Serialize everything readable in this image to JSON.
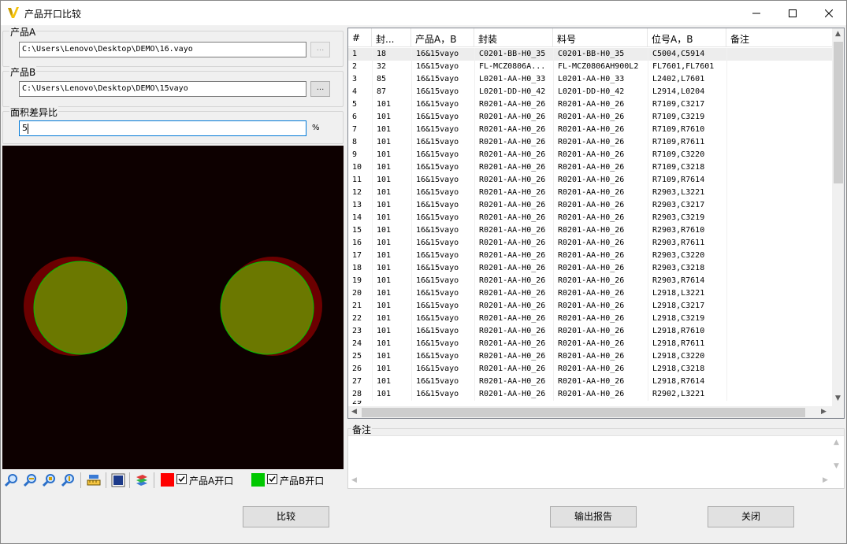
{
  "window": {
    "title": "产品开口比较"
  },
  "product_a": {
    "label": "产品A",
    "path": "C:\\Users\\Lenovo\\Desktop\\DEMO\\16.vayo",
    "browse_label": "..."
  },
  "product_b": {
    "label": "产品B",
    "path": "C:\\Users\\Lenovo\\Desktop\\DEMO\\15vayo",
    "browse_label": "..."
  },
  "area_diff": {
    "label": "面积差异比",
    "value": "5",
    "unit": "%"
  },
  "legend": {
    "a_label": "产品A开口",
    "a_color": "#ff0000",
    "a_checked": true,
    "b_label": "产品B开口",
    "b_color": "#00c800",
    "b_checked": true
  },
  "colors": {
    "canvas_bg": "#0d0000",
    "pad_a": "#6b0000",
    "pad_b": "#6b7800",
    "pad_b_outline": "#00c000"
  },
  "table": {
    "columns": [
      "#",
      "封...",
      "产品A，B",
      "封装",
      "料号",
      "位号A，B",
      "备注"
    ],
    "rows": [
      [
        "1",
        "18",
        "16&15vayo",
        "C0201-BB-H0_35",
        "C0201-BB-H0_35",
        "C5004,C5914",
        ""
      ],
      [
        "2",
        "32",
        "16&15vayo",
        "FL-MCZ0806A...",
        "FL-MCZ0806AH900L2",
        "FL7601,FL7601",
        ""
      ],
      [
        "3",
        "85",
        "16&15vayo",
        "L0201-AA-H0_33",
        "L0201-AA-H0_33",
        "L2402,L7601",
        ""
      ],
      [
        "4",
        "87",
        "16&15vayo",
        "L0201-DD-H0_42",
        "L0201-DD-H0_42",
        "L2914,L0204",
        ""
      ],
      [
        "5",
        "101",
        "16&15vayo",
        "R0201-AA-H0_26",
        "R0201-AA-H0_26",
        "R7109,C3217",
        ""
      ],
      [
        "6",
        "101",
        "16&15vayo",
        "R0201-AA-H0_26",
        "R0201-AA-H0_26",
        "R7109,C3219",
        ""
      ],
      [
        "7",
        "101",
        "16&15vayo",
        "R0201-AA-H0_26",
        "R0201-AA-H0_26",
        "R7109,R7610",
        ""
      ],
      [
        "8",
        "101",
        "16&15vayo",
        "R0201-AA-H0_26",
        "R0201-AA-H0_26",
        "R7109,R7611",
        ""
      ],
      [
        "9",
        "101",
        "16&15vayo",
        "R0201-AA-H0_26",
        "R0201-AA-H0_26",
        "R7109,C3220",
        ""
      ],
      [
        "10",
        "101",
        "16&15vayo",
        "R0201-AA-H0_26",
        "R0201-AA-H0_26",
        "R7109,C3218",
        ""
      ],
      [
        "11",
        "101",
        "16&15vayo",
        "R0201-AA-H0_26",
        "R0201-AA-H0_26",
        "R7109,R7614",
        ""
      ],
      [
        "12",
        "101",
        "16&15vayo",
        "R0201-AA-H0_26",
        "R0201-AA-H0_26",
        "R2903,L3221",
        ""
      ],
      [
        "13",
        "101",
        "16&15vayo",
        "R0201-AA-H0_26",
        "R0201-AA-H0_26",
        "R2903,C3217",
        ""
      ],
      [
        "14",
        "101",
        "16&15vayo",
        "R0201-AA-H0_26",
        "R0201-AA-H0_26",
        "R2903,C3219",
        ""
      ],
      [
        "15",
        "101",
        "16&15vayo",
        "R0201-AA-H0_26",
        "R0201-AA-H0_26",
        "R2903,R7610",
        ""
      ],
      [
        "16",
        "101",
        "16&15vayo",
        "R0201-AA-H0_26",
        "R0201-AA-H0_26",
        "R2903,R7611",
        ""
      ],
      [
        "17",
        "101",
        "16&15vayo",
        "R0201-AA-H0_26",
        "R0201-AA-H0_26",
        "R2903,C3220",
        ""
      ],
      [
        "18",
        "101",
        "16&15vayo",
        "R0201-AA-H0_26",
        "R0201-AA-H0_26",
        "R2903,C3218",
        ""
      ],
      [
        "19",
        "101",
        "16&15vayo",
        "R0201-AA-H0_26",
        "R0201-AA-H0_26",
        "R2903,R7614",
        ""
      ],
      [
        "20",
        "101",
        "16&15vayo",
        "R0201-AA-H0_26",
        "R0201-AA-H0_26",
        "L2918,L3221",
        ""
      ],
      [
        "21",
        "101",
        "16&15vayo",
        "R0201-AA-H0_26",
        "R0201-AA-H0_26",
        "L2918,C3217",
        ""
      ],
      [
        "22",
        "101",
        "16&15vayo",
        "R0201-AA-H0_26",
        "R0201-AA-H0_26",
        "L2918,C3219",
        ""
      ],
      [
        "23",
        "101",
        "16&15vayo",
        "R0201-AA-H0_26",
        "R0201-AA-H0_26",
        "L2918,R7610",
        ""
      ],
      [
        "24",
        "101",
        "16&15vayo",
        "R0201-AA-H0_26",
        "R0201-AA-H0_26",
        "L2918,R7611",
        ""
      ],
      [
        "25",
        "101",
        "16&15vayo",
        "R0201-AA-H0_26",
        "R0201-AA-H0_26",
        "L2918,C3220",
        ""
      ],
      [
        "26",
        "101",
        "16&15vayo",
        "R0201-AA-H0_26",
        "R0201-AA-H0_26",
        "L2918,C3218",
        ""
      ],
      [
        "27",
        "101",
        "16&15vayo",
        "R0201-AA-H0_26",
        "R0201-AA-H0_26",
        "L2918,R7614",
        ""
      ],
      [
        "28",
        "101",
        "16&15vayo",
        "R0201-AA-H0_26",
        "R0201-AA-H0_26",
        "R2902,L3221",
        ""
      ]
    ]
  },
  "note": {
    "label": "备注",
    "value": ""
  },
  "buttons": {
    "compare": "比较",
    "export": "输出报告",
    "close": "关闭"
  }
}
